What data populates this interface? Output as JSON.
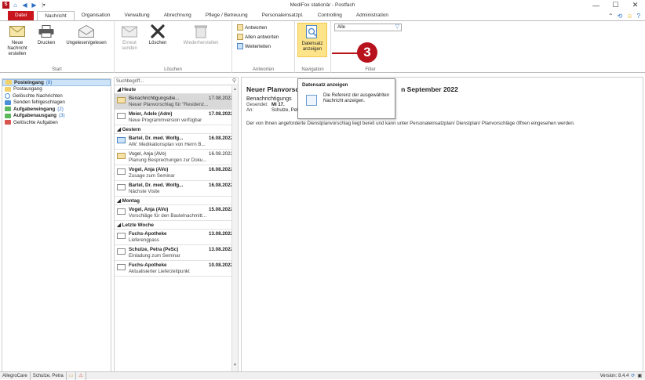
{
  "window": {
    "title": "MediFox stationär - Postfach",
    "controls": [
      "—",
      "☐",
      "✕"
    ]
  },
  "quick_access": {
    "logo": "S",
    "icons": [
      "house-icon",
      "arrow-left-icon",
      "arrow-right-icon",
      "qat-dropdown-icon"
    ]
  },
  "tabs": [
    {
      "label": "Datei",
      "kind": "file"
    },
    {
      "label": "Nachricht",
      "kind": "active"
    },
    {
      "label": "Organisation",
      "kind": ""
    },
    {
      "label": "Verwaltung",
      "kind": ""
    },
    {
      "label": "Abrechnung",
      "kind": ""
    },
    {
      "label": "Pflege / Betreuung",
      "kind": ""
    },
    {
      "label": "Personaleinsatzpl.",
      "kind": ""
    },
    {
      "label": "Controlling",
      "kind": ""
    },
    {
      "label": "Administration",
      "kind": ""
    }
  ],
  "ribbon": {
    "start": {
      "label": "Start",
      "new_message": "Neue Nachricht erstellen",
      "print": "Drucken",
      "mark_unread": "Ungelesen/gelesen"
    },
    "delete": {
      "label": "Löschen",
      "resend": "Erneut senden",
      "delete": "Löschen",
      "restore": "Wiederherstellen"
    },
    "reply": {
      "label": "Antworten",
      "reply": "Antworten",
      "reply_all": "Allen antworten",
      "forward": "Weiterleiten"
    },
    "navigation": {
      "label": "Navigation",
      "show_record": "Datensatz anzeigen"
    },
    "filter": {
      "label": "Filter",
      "value": "Alle"
    }
  },
  "folders": [
    {
      "label": "Posteingang",
      "count": "(8)",
      "bold": true,
      "selected": true,
      "color": "#f2d16b"
    },
    {
      "label": "Postausgang",
      "count": "",
      "bold": false,
      "selected": false,
      "color": "#f2d16b"
    },
    {
      "label": "Gelöschte Nachrichten",
      "count": "",
      "bold": false,
      "selected": false,
      "color": "#4a90d9"
    },
    {
      "label": "Senden fehlgeschlagen",
      "count": "",
      "bold": false,
      "selected": false,
      "color": "#d9534f"
    },
    {
      "label": "Aufgabeneingang",
      "count": "(2)",
      "bold": true,
      "selected": false,
      "color": "#5cb85c"
    },
    {
      "label": "Aufgabenausgang",
      "count": "(3)",
      "bold": true,
      "selected": false,
      "color": "#5cb85c"
    },
    {
      "label": "Gelöschte Aufgaben",
      "count": "",
      "bold": false,
      "selected": false,
      "color": "#d9534f"
    }
  ],
  "message_list": {
    "search_placeholder": "Suchbegriff...",
    "groups": [
      {
        "label": "Heute",
        "messages": [
          {
            "from": "Benachrichtigungsdie...",
            "date": "17.08.2022",
            "subject": "Neuer Planvorschlag für \"Residenz...",
            "selected": true,
            "unread": false,
            "icon": "open"
          },
          {
            "from": "Meier, Adele (Adm)",
            "date": "17.08.2022",
            "subject": "Neue Programmversion verfügbar",
            "selected": false,
            "unread": true,
            "icon": ""
          }
        ]
      },
      {
        "label": "Gestern",
        "messages": [
          {
            "from": "Bartel, Dr. med. Wolfg...",
            "date": "16.08.2022",
            "subject": "AW: Medikationsplan von Herrn B...",
            "selected": false,
            "unread": true,
            "icon": "info"
          },
          {
            "from": "Vogel, Anja (AVo)",
            "date": "16.08.2022",
            "subject": "Planung Besprechungen zur Doku...",
            "selected": false,
            "unread": false,
            "icon": "open"
          },
          {
            "from": "Vogel, Anja (AVo)",
            "date": "16.08.2022",
            "subject": "Zusage zum Seminar",
            "selected": false,
            "unread": true,
            "icon": ""
          },
          {
            "from": "Bartel, Dr. med. Wolfg...",
            "date": "16.08.2022",
            "subject": "Nächste Visite",
            "selected": false,
            "unread": true,
            "icon": ""
          }
        ]
      },
      {
        "label": "Montag",
        "messages": [
          {
            "from": "Vogel, Anja (AVo)",
            "date": "15.08.2022",
            "subject": "Vorschläge für den Bastelnachmitt...",
            "selected": false,
            "unread": true,
            "icon": ""
          }
        ]
      },
      {
        "label": "Letzte Woche",
        "messages": [
          {
            "from": "Fuchs-Apotheke",
            "date": "13.08.2022",
            "subject": "Lieferengpass",
            "selected": false,
            "unread": true,
            "icon": ""
          },
          {
            "from": "Schulze, Petra (PeSc)",
            "date": "13.08.2022",
            "subject": "Einladung zum Seminar",
            "selected": false,
            "unread": true,
            "icon": ""
          },
          {
            "from": "Fuchs-Apotheke",
            "date": "10.08.2022",
            "subject": "Aktualisierter Lieferzeitpunkt",
            "selected": false,
            "unread": true,
            "icon": ""
          }
        ]
      }
    ]
  },
  "reader": {
    "title_left": "Neuer Planvorsc",
    "title_right": "n September 2022",
    "subtitle": "Benachrichtigungs",
    "sent_key": "Gesendet:",
    "sent_value": "Mi 17.",
    "to_key": "An:",
    "to_value": "Schulze, Petra (PeSc)",
    "body": "Der von Ihnen angeforderte Dienstplanvorschlag liegt bereit und kann unter Personaleinsatzplan/ Dienstplan/ Planvorschläge öffnen eingesehen werden."
  },
  "tooltip": {
    "title": "Datensatz anzeigen",
    "text": "Die Referenz der ausgewählten Nachricht anzeigen."
  },
  "callout": {
    "number": "3"
  },
  "statusbar": {
    "company": "AllegroCare",
    "user": "Schulze, Petra",
    "version": "Version: 8.4.4"
  },
  "colors": {
    "accent": "#b8121c",
    "highlight": "#fde38a",
    "selection": "#cde3f7"
  }
}
